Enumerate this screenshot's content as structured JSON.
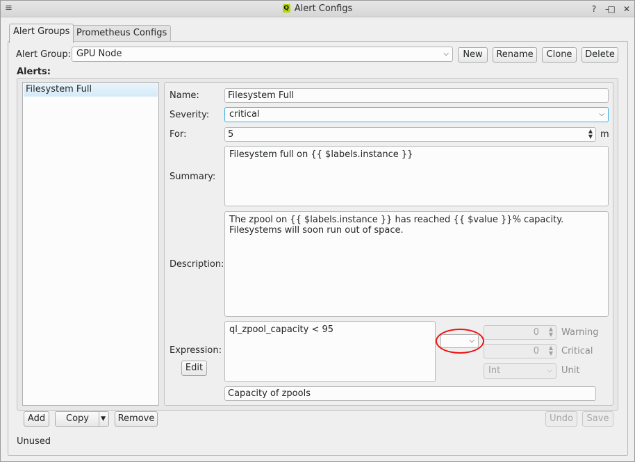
{
  "window": {
    "title": "Alert Configs",
    "app_icon_letter": "Q",
    "controls": {
      "menu": "≡",
      "help": "?",
      "minimize": "–",
      "maximize": "□",
      "close": "✕"
    }
  },
  "tabs": [
    {
      "label": "Alert Groups",
      "active": true
    },
    {
      "label": "Prometheus Configs",
      "active": false
    }
  ],
  "alert_group": {
    "label": "Alert Group:",
    "selected": "GPU Node",
    "buttons": {
      "new": "New",
      "rename": "Rename",
      "clone": "Clone",
      "delete": "Delete"
    }
  },
  "alerts": {
    "label": "Alerts:",
    "items": [
      "Filesystem Full"
    ],
    "buttons": {
      "add": "Add",
      "copy": "Copy",
      "remove": "Remove"
    }
  },
  "form": {
    "name_label": "Name:",
    "name_value": "Filesystem Full",
    "severity_label": "Severity:",
    "severity_value": "critical",
    "for_label": "For:",
    "for_value": "5",
    "for_unit": "m",
    "summary_label": "Summary:",
    "summary_value": "Filesystem full on {{ $labels.instance }}",
    "description_label": "Description:",
    "description_value": "The zpool on {{ $labels.instance }} has reached {{ $value }}% capacity. Filesystems will soon run out of space.",
    "expression_label": "Expression:",
    "expression_value": "ql_zpool_capacity < 95",
    "edit_button": "Edit",
    "operator_value": "",
    "warning_value": "0",
    "warning_label": "Warning",
    "critical_value": "0",
    "critical_label": "Critical",
    "unit_value": "Int",
    "unit_label": "Unit",
    "expression_comment": "Capacity of zpools"
  },
  "footer": {
    "undo": "Undo",
    "save": "Save",
    "status": "Unused"
  },
  "colors": {
    "focus_border": "#3daee9",
    "highlight_ring": "#ee1010",
    "app_icon": "#b6d500"
  }
}
